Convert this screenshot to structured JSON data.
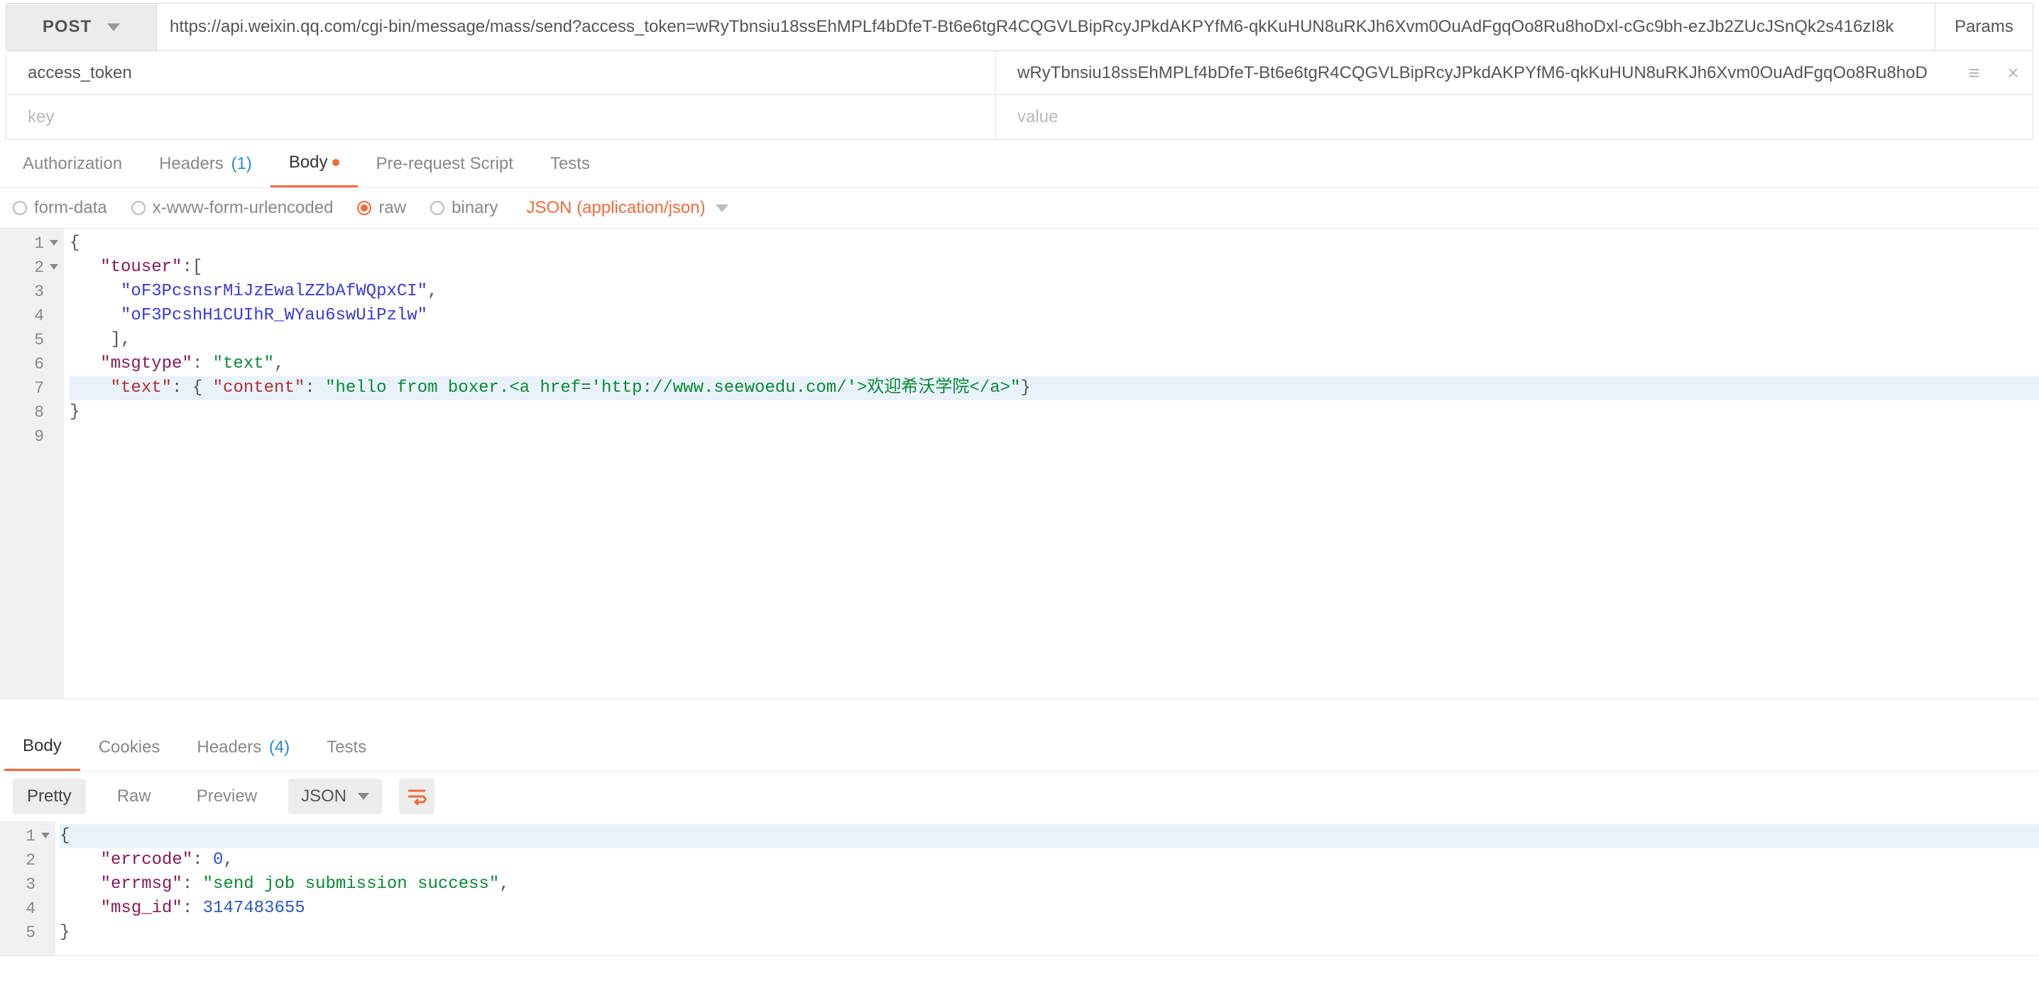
{
  "method": "POST",
  "url": "https://api.weixin.qq.com/cgi-bin/message/mass/send?access_token=wRyTbnsiu18ssEhMPLf4bDfeT-Bt6e6tgR4CQGVLBipRcyJPkdAKPYfM6-qkKuHUN8uRKJh6Xvm0OuAdFgqOo8Ru8hoDxl-cGc9bh-ezJb2ZUcJSnQk2s416zI8k",
  "params_button": "Params",
  "param_rows": [
    {
      "key": "access_token",
      "value": "wRyTbnsiu18ssEhMPLf4bDfeT-Bt6e6tgR4CQGVLBipRcyJPkdAKPYfM6-qkKuHUN8uRKJh6Xvm0OuAdFgqOo8Ru8hoD"
    }
  ],
  "param_placeholder_key": "key",
  "param_placeholder_value": "value",
  "request_tabs": {
    "authorization": "Authorization",
    "headers": "Headers",
    "headers_count": "(1)",
    "body": "Body",
    "prerequest": "Pre-request Script",
    "tests": "Tests"
  },
  "body_types": {
    "formdata": "form-data",
    "urlencoded": "x-www-form-urlencoded",
    "raw": "raw",
    "binary": "binary"
  },
  "raw_type_label": "JSON (application/json)",
  "request_body_lines": [
    {
      "n": "1",
      "fold": true,
      "tokens": [
        {
          "c": "p",
          "t": "{"
        }
      ]
    },
    {
      "n": "2",
      "fold": true,
      "tokens": [
        {
          "c": "p",
          "t": "   "
        },
        {
          "c": "k",
          "t": "\"touser\""
        },
        {
          "c": "p",
          "t": ":["
        }
      ]
    },
    {
      "n": "3",
      "fold": false,
      "tokens": [
        {
          "c": "p",
          "t": "     "
        },
        {
          "c": "sb",
          "t": "\"oF3PcsnsrMiJzEwalZZbAfWQpxCI\""
        },
        {
          "c": "p",
          "t": ","
        }
      ]
    },
    {
      "n": "4",
      "fold": false,
      "tokens": [
        {
          "c": "p",
          "t": "     "
        },
        {
          "c": "sb",
          "t": "\"oF3PcshH1CUIhR_WYau6swUiPzlw\""
        }
      ]
    },
    {
      "n": "5",
      "fold": false,
      "tokens": [
        {
          "c": "p",
          "t": "    ],"
        }
      ]
    },
    {
      "n": "6",
      "fold": false,
      "tokens": [
        {
          "c": "p",
          "t": "   "
        },
        {
          "c": "k",
          "t": "\"msgtype\""
        },
        {
          "c": "p",
          "t": ": "
        },
        {
          "c": "sg",
          "t": "\"text\""
        },
        {
          "c": "p",
          "t": ","
        }
      ]
    },
    {
      "n": "7",
      "fold": false,
      "hl": true,
      "tokens": [
        {
          "c": "p",
          "t": "    "
        },
        {
          "c": "sr",
          "t": "\"text\""
        },
        {
          "c": "p",
          "t": ": { "
        },
        {
          "c": "sr",
          "t": "\"content\""
        },
        {
          "c": "p",
          "t": ": "
        },
        {
          "c": "sg",
          "t": "\"hello from boxer.<a href='http://www.seewoedu.com/'>欢迎希沃学院</a>\""
        },
        {
          "c": "p",
          "t": "}"
        }
      ]
    },
    {
      "n": "8",
      "fold": false,
      "tokens": [
        {
          "c": "p",
          "t": "}"
        }
      ]
    },
    {
      "n": "9",
      "fold": false,
      "tokens": []
    }
  ],
  "response_tabs": {
    "body": "Body",
    "cookies": "Cookies",
    "headers": "Headers",
    "headers_count": "(4)",
    "tests": "Tests"
  },
  "response_toolbar": {
    "pretty": "Pretty",
    "raw": "Raw",
    "preview": "Preview",
    "format_select": "JSON"
  },
  "response_body_lines": [
    {
      "n": "1",
      "fold": true,
      "hl": true,
      "tokens": [
        {
          "c": "p",
          "t": "{"
        }
      ]
    },
    {
      "n": "2",
      "fold": false,
      "tokens": [
        {
          "c": "p",
          "t": "    "
        },
        {
          "c": "k",
          "t": "\"errcode\""
        },
        {
          "c": "p",
          "t": ": "
        },
        {
          "c": "nb",
          "t": "0"
        },
        {
          "c": "p",
          "t": ","
        }
      ]
    },
    {
      "n": "3",
      "fold": false,
      "tokens": [
        {
          "c": "p",
          "t": "    "
        },
        {
          "c": "k",
          "t": "\"errmsg\""
        },
        {
          "c": "p",
          "t": ": "
        },
        {
          "c": "sg",
          "t": "\"send job submission success\""
        },
        {
          "c": "p",
          "t": ","
        }
      ]
    },
    {
      "n": "4",
      "fold": false,
      "tokens": [
        {
          "c": "p",
          "t": "    "
        },
        {
          "c": "k",
          "t": "\"msg_id\""
        },
        {
          "c": "p",
          "t": ": "
        },
        {
          "c": "nb",
          "t": "3147483655"
        }
      ]
    },
    {
      "n": "5",
      "fold": false,
      "tokens": [
        {
          "c": "p",
          "t": "}"
        }
      ]
    }
  ]
}
